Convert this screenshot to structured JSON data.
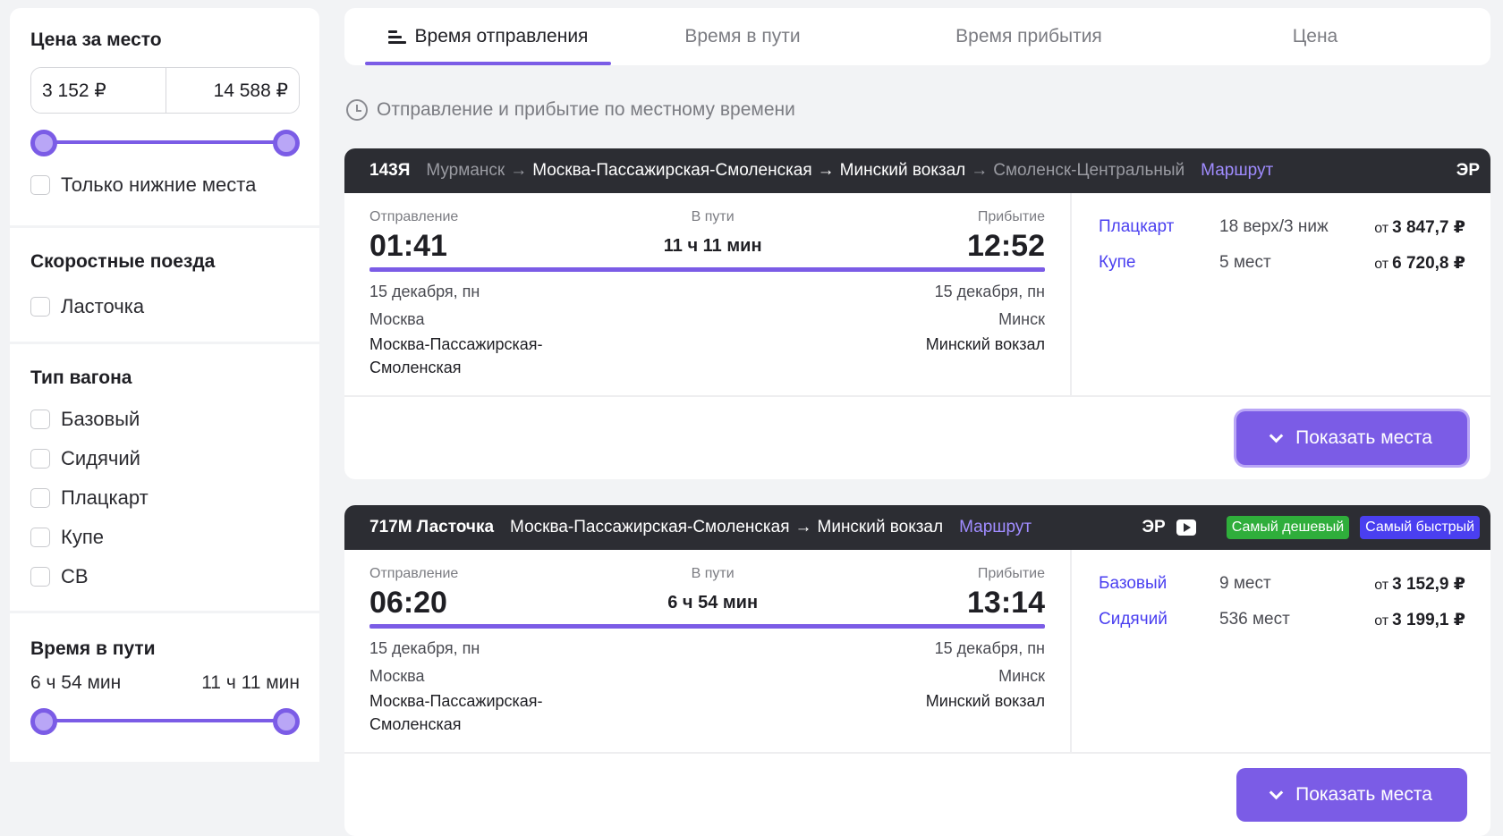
{
  "filters": {
    "price": {
      "title": "Цена за место",
      "from": "3 152 ₽",
      "to": "14 588 ₽",
      "slider_low_fraction": 0.0,
      "slider_high_fraction": 1.0,
      "lower_only_label": "Только нижние места"
    },
    "fast_trains": {
      "title": "Скоростные поезда",
      "items": [
        "Ласточка"
      ]
    },
    "car_type": {
      "title": "Тип вагона",
      "items": [
        "Базовый",
        "Сидячий",
        "Плацкарт",
        "Купе",
        "СВ"
      ]
    },
    "travel_time": {
      "title": "Время в пути",
      "from": "6 ч 54 мин",
      "to": "11 ч 11 мин",
      "slider_low_fraction": 0.0,
      "slider_high_fraction": 1.0
    }
  },
  "sort": {
    "tabs": [
      "Время отправления",
      "Время в пути",
      "Время прибытия",
      "Цена"
    ],
    "active": 0
  },
  "tz_note": "Отправление и прибытие по местному времени",
  "labels": {
    "departure": "Отправление",
    "in_transit": "В пути",
    "arrival": "Прибытие",
    "route_link": "Маршрут",
    "show_seats": "Показать места",
    "from": "от",
    "er": "ЭР"
  },
  "trains": [
    {
      "number": "143Я",
      "route_before": "Мурманск",
      "route_from": "Москва-Пассажирская-Смоленская",
      "route_to": "Минский вокзал",
      "route_after": "Смоленск-Центральный",
      "dep_time": "01:41",
      "duration": "11 ч 11 мин",
      "arr_time": "12:52",
      "dep_date": "15 декабря, пн",
      "arr_date": "15 декабря, пн",
      "dep_city": "Москва",
      "dep_station_1": "Москва-Пассажирская-",
      "dep_station_2": "Смоленская",
      "arr_city": "Минск",
      "arr_station": "Минский вокзал",
      "prices": [
        {
          "type": "Плацкарт",
          "seats": "18 верх/3 ниж",
          "price": "3 847,7 ₽"
        },
        {
          "type": "Купе",
          "seats": "5 мест",
          "price": "6 720,8 ₽"
        }
      ]
    },
    {
      "number": "717М Ласточка",
      "route_from": "Москва-Пассажирская-Смоленская",
      "route_to": "Минский вокзал",
      "badge_cheapest": "Самый дешевый",
      "badge_fastest": "Самый быстрый",
      "dep_time": "06:20",
      "duration": "6 ч 54 мин",
      "arr_time": "13:14",
      "dep_date": "15 декабря, пн",
      "arr_date": "15 декабря, пн",
      "dep_city": "Москва",
      "dep_station_1": "Москва-Пассажирская-",
      "dep_station_2": "Смоленская",
      "arr_city": "Минск",
      "arr_station": "Минский вокзал",
      "prices": [
        {
          "type": "Базовый",
          "seats": "9 мест",
          "price": "3 152,9 ₽"
        },
        {
          "type": "Сидячий",
          "seats": "536 мест",
          "price": "3 199,1 ₽"
        }
      ]
    }
  ]
}
